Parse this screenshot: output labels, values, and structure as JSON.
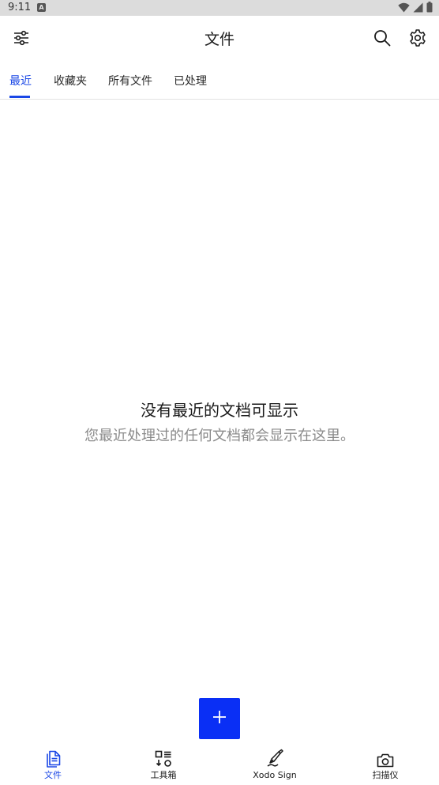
{
  "status_bar": {
    "time": "9:11",
    "notification_icon": "a-icon",
    "icons": [
      "wifi-icon",
      "signal-icon",
      "battery-icon"
    ]
  },
  "app_bar": {
    "title": "文件",
    "left_icon": "filter-sliders-icon",
    "right_icons": [
      "search-icon",
      "gear-icon"
    ]
  },
  "tabs": {
    "items": [
      {
        "label": "最近",
        "active": true
      },
      {
        "label": "收藏夹",
        "active": false
      },
      {
        "label": "所有文件",
        "active": false
      },
      {
        "label": "已处理",
        "active": false
      }
    ],
    "accent_color": "#1a47e6"
  },
  "empty_state": {
    "title": "没有最近的文档可显示",
    "subtitle": "您最近处理过的任何文档都会显示在这里。"
  },
  "fab": {
    "icon": "plus-icon",
    "color": "#0a2ff5"
  },
  "bottom_nav": {
    "items": [
      {
        "label": "文件",
        "icon": "document-icon",
        "active": true
      },
      {
        "label": "工具箱",
        "icon": "toolbox-icon",
        "active": false
      },
      {
        "label": "Xodo Sign",
        "icon": "pen-nib-icon",
        "active": false
      },
      {
        "label": "扫描仪",
        "icon": "camera-icon",
        "active": false
      }
    ]
  }
}
